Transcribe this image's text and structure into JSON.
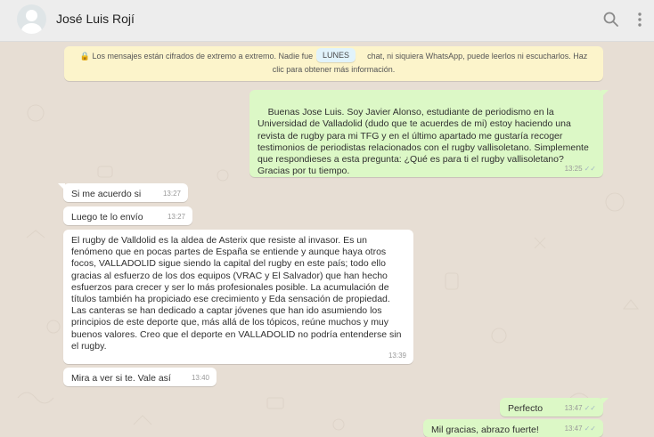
{
  "header": {
    "contact_name": "José Luis Rojí",
    "icons": [
      "avatar",
      "search-icon",
      "menu-dots-icon"
    ]
  },
  "encryption_notice": {
    "text_before": "Los mensajes están cifrados de extremo a extremo. Nadie fue",
    "text_after": "chat, ni siquiera WhatsApp, puede leerlos ni escucharlos. Haz clic para obtener más información.",
    "icon": "lock-icon"
  },
  "day_chip": "LUNES",
  "messages": [
    {
      "direction": "out",
      "text": "Buenas Jose Luis. Soy Javier Alonso, estudiante de periodismo en la Universidad de Valladolid (dudo que te acuerdes de mi) estoy haciendo una revista de rugby para mi TFG y en el último apartado me gustaría recoger testimonios de periodistas relacionados con el rugby vallisoletano. Simplemente que respondieses a esta pregunta: ¿Qué es para ti el rugby vallisoletano?\nGracias por tu tiempo.",
      "time": "13:25"
    },
    {
      "direction": "in",
      "text": "Si me acuerdo si",
      "time": "13:27"
    },
    {
      "direction": "in",
      "text": "Luego te lo envío",
      "time": "13:27"
    },
    {
      "direction": "in",
      "text": "El rugby de Valldolid es la aldea de Asterix que resiste al invasor. Es un fenómeno que en pocas partes de España se entiende y aunque haya otros focos, VALLADOLID sigue siendo la capital del rugby en este país; todo ello gracias al esfuerzo de los dos equipos (VRAC y El Salvador) que han hecho esfuerzos para crecer y ser lo más profesionales posible. La acumulación de títulos también ha propiciado ese crecimiento y Eda sensación de propiedad. Las canteras se han dedicado a captar jóvenes que han ido asumiendo los principios de este deporte que, más allá de los tópicos, reúne muchos y muy buenos valores. Creo que el deporte en VALLADOLID no podría entenderse sin el rugby.",
      "time": "13:39"
    },
    {
      "direction": "in",
      "text": "Mira a ver si te. Vale así",
      "time": "13:40"
    },
    {
      "direction": "out",
      "text": "Perfecto",
      "time": "13:47"
    },
    {
      "direction": "out",
      "text": "Mil gracias, abrazo fuerte!",
      "time": "13:47"
    }
  ],
  "colors": {
    "outgoing_bubble": "#dcf8c6",
    "incoming_bubble": "#ffffff",
    "wallpaper": "#e7ded4",
    "notice": "#fcf4cb",
    "header": "#ededed"
  }
}
